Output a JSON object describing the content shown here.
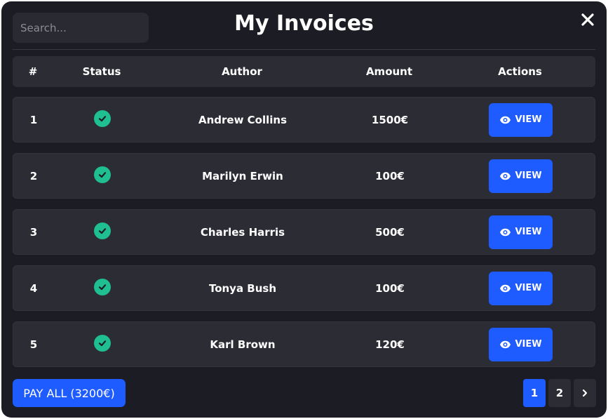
{
  "header": {
    "title": "My Invoices",
    "search_placeholder": "Search..."
  },
  "table": {
    "columns": [
      "#",
      "Status",
      "Author",
      "Amount",
      "Actions"
    ],
    "rows": [
      {
        "num": "1",
        "status": "paid",
        "author": "Andrew Collins",
        "amount": "1500€",
        "action": "VIEW"
      },
      {
        "num": "2",
        "status": "paid",
        "author": "Marilyn Erwin",
        "amount": "100€",
        "action": "VIEW"
      },
      {
        "num": "3",
        "status": "paid",
        "author": "Charles Harris",
        "amount": "500€",
        "action": "VIEW"
      },
      {
        "num": "4",
        "status": "paid",
        "author": "Tonya Bush",
        "amount": "100€",
        "action": "VIEW"
      },
      {
        "num": "5",
        "status": "paid",
        "author": "Karl Brown",
        "amount": "120€",
        "action": "VIEW"
      }
    ]
  },
  "footer": {
    "pay_all_label": "PAY ALL (3200€)",
    "pagination": {
      "pages": [
        "1",
        "2"
      ],
      "current": "1",
      "next_icon": "chevron-right-icon"
    }
  },
  "icons": {
    "close": "close-icon",
    "status": "check-circle-icon",
    "view": "eye-icon"
  },
  "colors": {
    "background": "#1c1c24",
    "panel": "#2c2c35",
    "accent": "#1f5cff",
    "success": "#1fbf8f"
  }
}
